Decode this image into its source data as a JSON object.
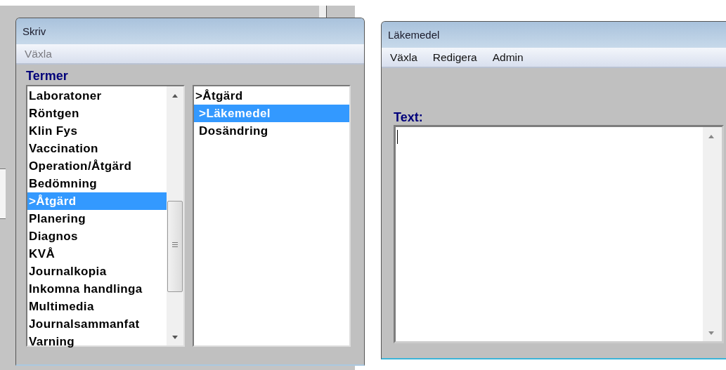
{
  "left_window": {
    "title": "Skriv",
    "menu": [
      {
        "label": "Växla",
        "disabled": true
      }
    ],
    "section_label": "Termer",
    "terms": [
      {
        "label": "Laboratoner",
        "selected": false
      },
      {
        "label": "Röntgen",
        "selected": false
      },
      {
        "label": "Klin Fys",
        "selected": false
      },
      {
        "label": "Vaccination",
        "selected": false
      },
      {
        "label": "Operation/Åtgärd",
        "selected": false
      },
      {
        "label": "Bedömning",
        "selected": false
      },
      {
        "label": ">Åtgärd",
        "selected": true
      },
      {
        "label": "Planering",
        "selected": false
      },
      {
        "label": "Diagnos",
        "selected": false
      },
      {
        "label": "KVÅ",
        "selected": false
      },
      {
        "label": "Journalkopia",
        "selected": false
      },
      {
        "label": "Inkomna handlinga",
        "selected": false
      },
      {
        "label": "Multimedia",
        "selected": false
      },
      {
        "label": "Journalsammanfat",
        "selected": false
      },
      {
        "label": "Varning",
        "selected": false
      }
    ],
    "subterms": [
      {
        "label": ">Åtgärd",
        "selected": false
      },
      {
        "label": " >Läkemedel",
        "selected": true
      },
      {
        "label": " Dosändring",
        "selected": false
      }
    ]
  },
  "right_window": {
    "title": "Läkemedel",
    "menu": [
      {
        "label": "Växla",
        "disabled": false
      },
      {
        "label": "Redigera",
        "disabled": false
      },
      {
        "label": "Admin",
        "disabled": false
      }
    ],
    "field_label": "Text:"
  }
}
